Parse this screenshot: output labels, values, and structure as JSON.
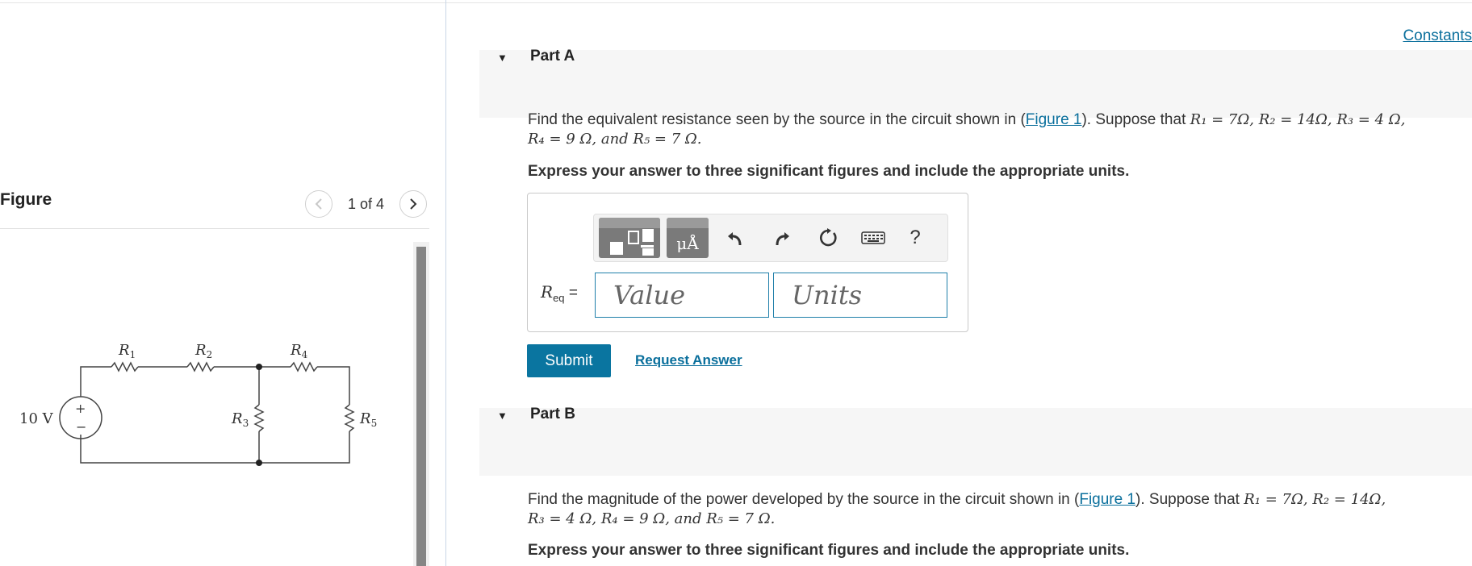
{
  "figure": {
    "title": "Figure",
    "page": "1 of 4",
    "circuit": {
      "source": "10 V",
      "source_plus": "+",
      "source_minus": "−",
      "resistors": {
        "r1": "R",
        "r2": "R",
        "r3": "R",
        "r4": "R",
        "r5": "R"
      },
      "subscripts": {
        "r1": "1",
        "r2": "2",
        "r3": "3",
        "r4": "4",
        "r5": "5"
      }
    }
  },
  "header": {
    "constants_link": "Constants"
  },
  "part_a": {
    "title": "Part A",
    "problem_prefix": "Find the equivalent resistance seen by the source in the circuit shown in (",
    "figure_link": "Figure 1",
    "problem_suffix": "). Suppose that ",
    "values_line1": "R₁ = 7Ω, R₂ = 14Ω, R₃ = 4 Ω,",
    "values_line2": "R₄ = 9 Ω, and R₅ = 7 Ω.",
    "instructions": "Express your answer to three significant figures and include the appropriate units.",
    "answer_label_main": "R",
    "answer_label_sub": "eq",
    "answer_label_eq": "=",
    "value_placeholder": "Value",
    "units_placeholder": "Units",
    "template_units_label": "μÅ",
    "help_label": "?",
    "submit_label": "Submit",
    "request_answer_label": "Request Answer"
  },
  "part_b": {
    "title": "Part B",
    "problem_prefix": "Find the magnitude of the power developed by the source in the circuit shown in (",
    "figure_link": "Figure 1",
    "problem_suffix": "). Suppose that ",
    "values_line1": "R₁ = 7Ω, R₂ = 14Ω,",
    "values_line2": "R₃ = 4 Ω, R₄ = 9 Ω, and R₅ = 7 Ω.",
    "instructions": "Express your answer to three significant figures and include the appropriate units."
  }
}
